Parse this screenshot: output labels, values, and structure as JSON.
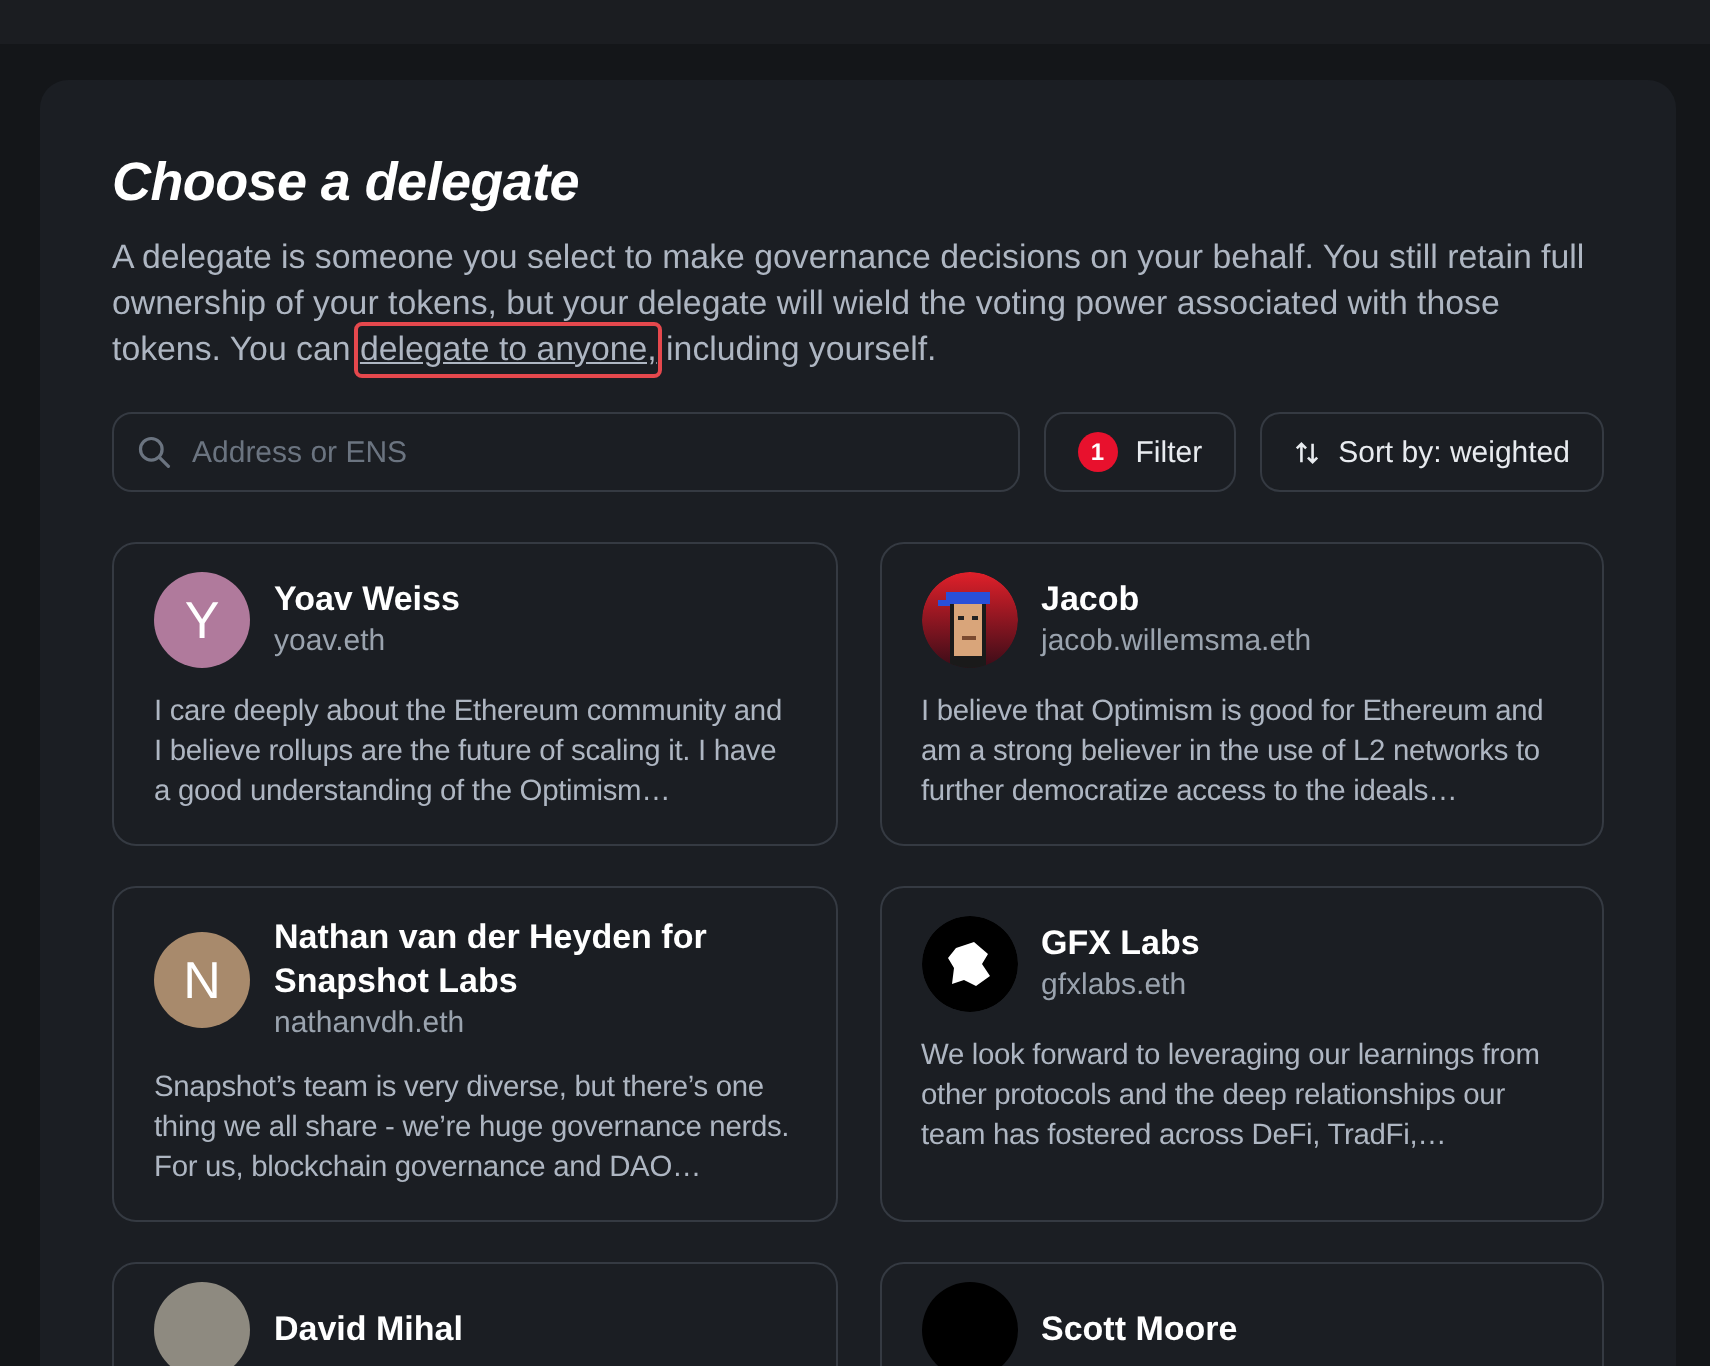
{
  "title": "Choose a delegate",
  "intro": {
    "before": "A delegate is someone you select to make governance decisions on your behalf. You still retain full ownership of your tokens, but your delegate will wield the voting power associated with those tokens. You can ",
    "link": "delegate to anyone,",
    "link_highlighted": true,
    "after": " including yourself."
  },
  "search": {
    "placeholder": "Address or ENS"
  },
  "filter": {
    "label": "Filter",
    "count": "1"
  },
  "sort": {
    "label": "Sort by: weighted"
  },
  "delegates": [
    {
      "name": "Yoav Weiss",
      "ens": "yoav.eth",
      "avatar": {
        "kind": "letter",
        "letter": "Y",
        "color": "#b07a9c"
      },
      "statement": "I care deeply about the Ethereum community and I believe rollups are the future of scaling it. I have a good understanding of the Optimism…"
    },
    {
      "name": "Jacob",
      "ens": "jacob.willemsma.eth",
      "avatar": {
        "kind": "pixel"
      },
      "statement": "I believe that Optimism is good for Ethereum and am a strong believer in the use of L2 networks to further democratize access to the ideals…"
    },
    {
      "name": "Nathan van der Heyden for Snapshot Labs",
      "ens": "nathanvdh.eth",
      "avatar": {
        "kind": "letter",
        "letter": "N",
        "color": "#a88a6c"
      },
      "statement": "Snapshot’s team is very diverse, but there’s one thing we all share - we’re huge governance nerds. For us, blockchain governance and DAO…"
    },
    {
      "name": "GFX Labs",
      "ens": "gfxlabs.eth",
      "avatar": {
        "kind": "logo"
      },
      "statement": "We look forward to leveraging our learnings from other protocols and the deep relationships our team has fostered across DeFi, TradFi,…"
    },
    {
      "name": "David Mihal",
      "avatar": {
        "kind": "photo"
      }
    },
    {
      "name": "Scott Moore",
      "avatar": {
        "kind": "blank"
      }
    }
  ]
}
